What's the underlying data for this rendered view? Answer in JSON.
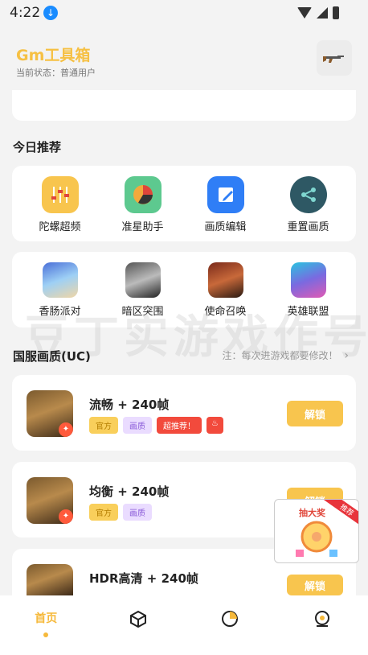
{
  "status": {
    "time": "4:22"
  },
  "header": {
    "title": "Gm工具箱",
    "subtitle": "当前状态：普通用户"
  },
  "today": {
    "title": "今日推荐",
    "items": [
      {
        "label": "陀螺超频",
        "icon": "sliders-icon"
      },
      {
        "label": "准星助手",
        "icon": "pie-chart-icon"
      },
      {
        "label": "画质编辑",
        "icon": "edit-icon"
      },
      {
        "label": "重置画质",
        "icon": "share-icon"
      }
    ]
  },
  "games": {
    "items": [
      {
        "label": "香肠派对"
      },
      {
        "label": "暗区突围"
      },
      {
        "label": "使命召唤"
      },
      {
        "label": "英雄联盟"
      }
    ]
  },
  "watermark": "豆丁实游戏作号",
  "cn_section": {
    "title": "国服画质(UC)",
    "note": "注：每次进游戏都要修改！"
  },
  "presets": [
    {
      "title": "流畅 + 240帧",
      "tags": [
        "官方",
        "画质",
        "超推荐！"
      ],
      "button": "解锁"
    },
    {
      "title": "均衡 + 240帧",
      "tags": [
        "官方",
        "画质"
      ],
      "button": "解锁"
    },
    {
      "title": "HDR高清 + 240帧",
      "tags": [],
      "button": "解锁"
    }
  ],
  "lottery": {
    "title": "抽大奖",
    "ribbon": "推荐"
  },
  "nav": {
    "home": "首页"
  },
  "colors": {
    "accent": "#f6c043",
    "unlock": "#f8c54e",
    "hot": "#f24a3c"
  }
}
